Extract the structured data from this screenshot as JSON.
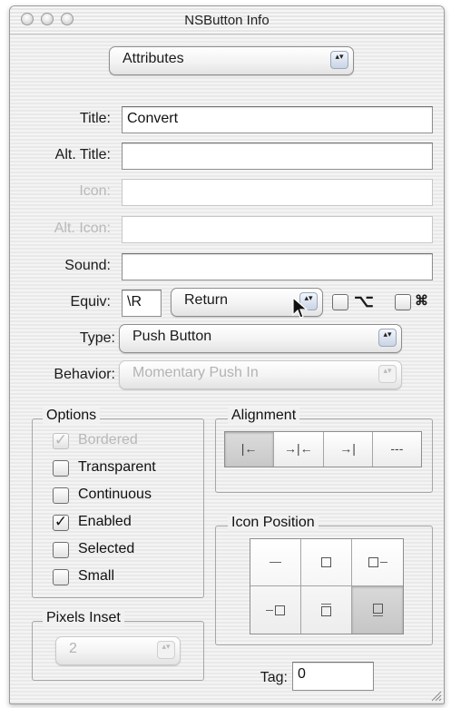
{
  "window": {
    "title": "NSButton Info"
  },
  "inspector_popup": {
    "value": "Attributes"
  },
  "fields": {
    "title": {
      "label": "Title:",
      "value": "Convert"
    },
    "alt_title": {
      "label": "Alt. Title:",
      "value": ""
    },
    "icon": {
      "label": "Icon:",
      "value": ""
    },
    "alt_icon": {
      "label": "Alt. Icon:",
      "value": ""
    },
    "sound": {
      "label": "Sound:",
      "value": ""
    },
    "equiv": {
      "label": "Equiv:",
      "value": "\\R",
      "key_popup": "Return",
      "option_symbol": "⌥",
      "command_symbol": "⌘"
    }
  },
  "type": {
    "label": "Type:",
    "value": "Push Button"
  },
  "behavior": {
    "label": "Behavior:",
    "value": "Momentary Push In"
  },
  "options": {
    "title": "Options",
    "items": [
      {
        "label": "Bordered",
        "checked": true,
        "enabled": false
      },
      {
        "label": "Transparent",
        "checked": false,
        "enabled": true
      },
      {
        "label": "Continuous",
        "checked": false,
        "enabled": true
      },
      {
        "label": "Enabled",
        "checked": true,
        "enabled": true
      },
      {
        "label": "Selected",
        "checked": false,
        "enabled": true
      },
      {
        "label": "Small",
        "checked": false,
        "enabled": true
      }
    ]
  },
  "alignment": {
    "title": "Alignment",
    "segments": [
      "|←",
      "→|←",
      "→|",
      "---"
    ],
    "selected_index": 0
  },
  "icon_position": {
    "title": "Icon Position",
    "selected_index": 5
  },
  "pixels_inset": {
    "title": "Pixels Inset",
    "value": "2"
  },
  "tag": {
    "label": "Tag:",
    "value": "0"
  },
  "checkmark_glyph": "✓",
  "stepper_glyph": "▴▾"
}
